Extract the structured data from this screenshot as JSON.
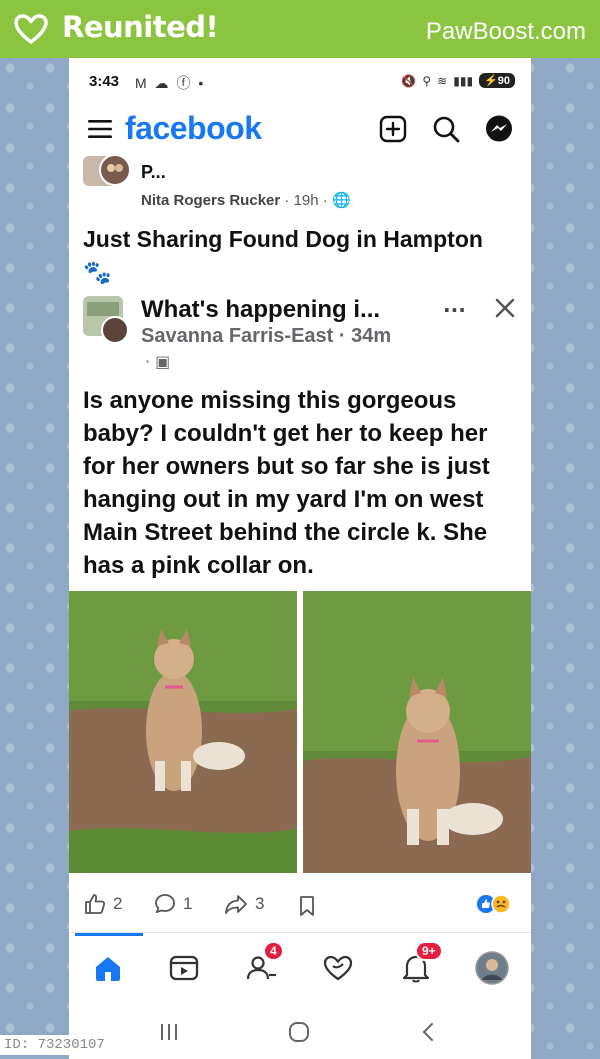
{
  "banner": {
    "title": "Reunited!",
    "brand": "PawBoost.com"
  },
  "status_bar": {
    "time": "3:43",
    "notifications": "M ☁ ⓕ •",
    "battery": "90"
  },
  "app_bar": {
    "logo": "facebook"
  },
  "post": {
    "group_title": "P...",
    "author": "Nita Rogers Rucker",
    "time": "19h",
    "separator": "·",
    "text": "Just Sharing Found Dog in Hampton 🐾",
    "shared": {
      "group_title": "What's happening i...",
      "author": "Savanna Farris-East",
      "time": "34m",
      "more": "···",
      "body": "Is anyone missing this gorgeous baby? I couldn't get her to keep her for her owners but so far she is just hanging out in my yard I'm on west Main Street behind the circle k. She has a pink collar on."
    },
    "actions": {
      "likes": "2",
      "comments": "1",
      "shares": "3"
    }
  },
  "nav": {
    "friends_badge": "4",
    "notifications_badge": "9+"
  },
  "footer": {
    "id_label": "ID: 73230107"
  },
  "colors": {
    "banner": "#8bc53f",
    "facebook_blue": "#1877f2",
    "badge_red": "#e41e3f",
    "background": "#8fa9c4"
  }
}
